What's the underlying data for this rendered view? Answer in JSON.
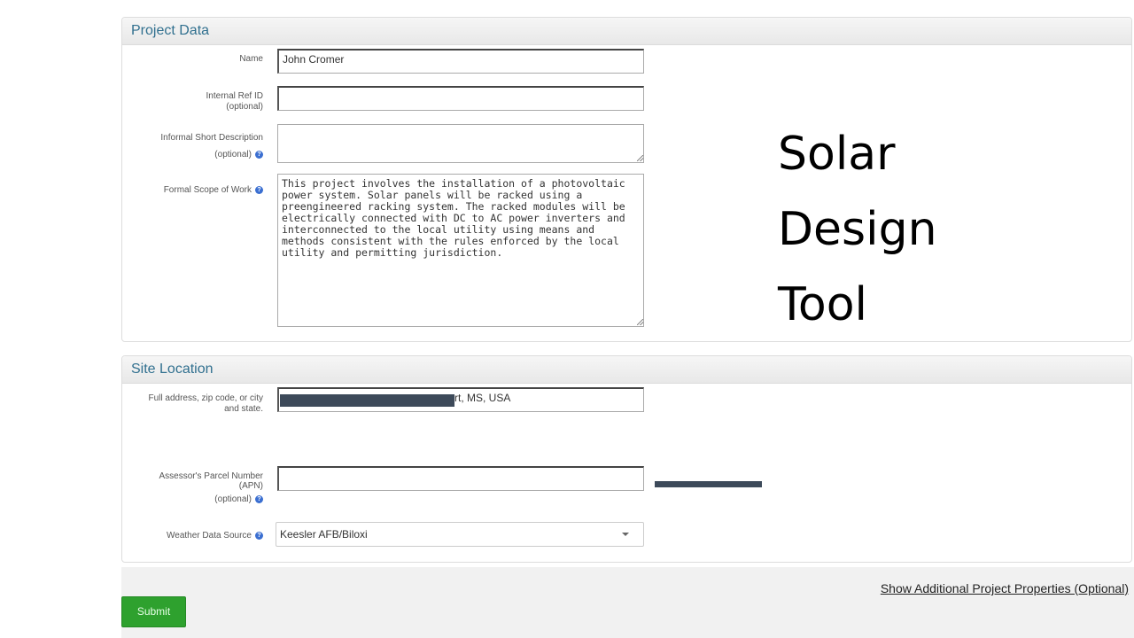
{
  "project_data": {
    "heading": "Project Data",
    "name_label": "Name",
    "name_value": "John Cromer",
    "ref_label_1": "Internal Ref ID",
    "ref_label_2": "(optional)",
    "ref_value": "",
    "short_desc_label_1": "Informal Short Description",
    "short_desc_label_2": "(optional)",
    "short_desc_value": "",
    "scope_label": "Formal Scope of Work",
    "scope_value": "This project involves the installation of a photovoltaic power system. Solar panels will be racked using a preengineered racking system. The racked modules will be electrically connected with DC to AC power inverters and interconnected to the local utility using means and methods consistent with the rules enforced by the local utility and permitting jurisdiction."
  },
  "site_location": {
    "heading": "Site Location",
    "address_label_1": "Full address, zip code, or city",
    "address_label_2": "and state.",
    "address_visible_suffix": "rt, MS, USA",
    "apn_label_1": "Assessor's Parcel Number",
    "apn_label_2": "(APN)",
    "apn_label_3": "(optional)",
    "apn_value": "",
    "weather_label": "Weather Data Source",
    "weather_value": "Keesler AFB/Biloxi"
  },
  "overlay_title": [
    "Solar",
    "Design",
    "Tool"
  ],
  "footer": {
    "show_more": "Show Additional Project Properties (Optional)",
    "submit": "Submit"
  },
  "colors": {
    "heading_text": "#31708f",
    "submit_bg": "#2ea12e",
    "redaction": "#3d4a5a",
    "help_icon": "#3b6fd1"
  },
  "icons": {
    "help": "question-circle-icon",
    "dropdown": "caret-down-icon",
    "resize": "resize-grip-icon"
  }
}
